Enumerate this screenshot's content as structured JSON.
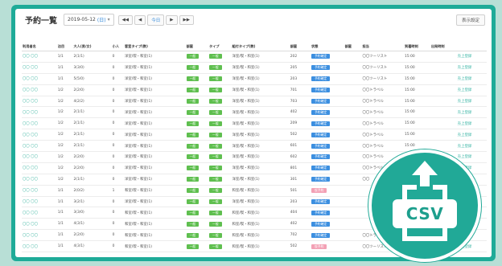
{
  "header": {
    "title": "予約一覧",
    "date_value": "2019-05-12",
    "weekday": "(日)",
    "caret": "▾",
    "nav_first": "◀◀",
    "nav_prev": "◀",
    "nav_today": "今日",
    "nav_next": "▶",
    "nav_last": "▶▶",
    "settings_button": "表示設定"
  },
  "table": {
    "columns": [
      "利用者名",
      "泊目",
      "大人(男/女)",
      "小人",
      "客室タイプ(数)",
      "部屋",
      "タイプ",
      "組付タイプ(数)",
      "部屋",
      "状態",
      "部屋",
      "担当",
      "到着時刻",
      "出発時刻",
      ""
    ],
    "rows": [
      {
        "name": "〇〇 〇〇",
        "nights": "1/1",
        "adults": "2(1/1)",
        "children": "0",
        "room_type": "洋室/喫・和室(1)",
        "tag1": "一般",
        "tag2": "一般",
        "combo": "洋室/喫・和室(1)",
        "room": "202",
        "status": "予約確定",
        "status_pink": false,
        "agent": "〇〇ツーリスト",
        "arrival": "15:00",
        "link": "売上登録"
      },
      {
        "name": "〇〇 〇〇",
        "nights": "1/1",
        "adults": "3(3/0)",
        "children": "0",
        "room_type": "洋室/喫・和室(1)",
        "tag1": "一般",
        "tag2": "一般",
        "combo": "洋室/喫・和室(1)",
        "room": "205",
        "status": "予約確定",
        "status_pink": false,
        "agent": "〇〇ツーリスト",
        "arrival": "15:00",
        "link": "売上登録"
      },
      {
        "name": "〇〇 〇〇",
        "nights": "1/1",
        "adults": "5(5/0)",
        "children": "0",
        "room_type": "洋室/喫・和室(1)",
        "tag1": "一般",
        "tag2": "一般",
        "combo": "洋室/喫・和室(1)",
        "room": "203",
        "status": "予約確定",
        "status_pink": false,
        "agent": "〇〇ツーリスト",
        "arrival": "15:00",
        "link": "売上登録"
      },
      {
        "name": "〇〇 〇〇",
        "nights": "1/2",
        "adults": "2(2/0)",
        "children": "0",
        "room_type": "洋室/喫・和室(1)",
        "tag1": "一般",
        "tag2": "一般",
        "combo": "洋室/喫・和室(1)",
        "room": "701",
        "status": "予約確定",
        "status_pink": false,
        "agent": "〇〇トラベル",
        "arrival": "15:00",
        "link": "売上登録"
      },
      {
        "name": "〇〇 〇〇",
        "nights": "1/2",
        "adults": "4(2/2)",
        "children": "0",
        "room_type": "洋室/喫・和室(1)",
        "tag1": "一般",
        "tag2": "一般",
        "combo": "洋室/喫・和室(1)",
        "room": "703",
        "status": "予約確定",
        "status_pink": false,
        "agent": "〇〇トラベル",
        "arrival": "15:00",
        "link": "売上登録"
      },
      {
        "name": "〇〇 〇〇",
        "nights": "1/2",
        "adults": "2(1/1)",
        "children": "0",
        "room_type": "洋室/喫・和室(1)",
        "tag1": "一般",
        "tag2": "一般",
        "combo": "洋室/喫・和室(1)",
        "room": "402",
        "status": "予約確定",
        "status_pink": false,
        "agent": "〇〇トラベル",
        "arrival": "15:00",
        "link": "売上登録"
      },
      {
        "name": "〇〇 〇〇",
        "nights": "1/2",
        "adults": "2(1/1)",
        "children": "0",
        "room_type": "洋室/喫・和室(1)",
        "tag1": "一般",
        "tag2": "一般",
        "combo": "洋室/喫・和室(1)",
        "room": "209",
        "status": "予約確定",
        "status_pink": false,
        "agent": "〇〇トラベル",
        "arrival": "15:00",
        "link": "売上登録"
      },
      {
        "name": "〇〇 〇〇",
        "nights": "1/2",
        "adults": "2(1/1)",
        "children": "0",
        "room_type": "洋室/喫・和室(1)",
        "tag1": "一般",
        "tag2": "一般",
        "combo": "洋室/喫・和室(1)",
        "room": "502",
        "status": "予約確定",
        "status_pink": false,
        "agent": "〇〇トラベル",
        "arrival": "15:00",
        "link": "売上登録"
      },
      {
        "name": "〇〇 〇〇",
        "nights": "1/2",
        "adults": "2(1/1)",
        "children": "0",
        "room_type": "洋室/喫・和室(1)",
        "tag1": "一般",
        "tag2": "一般",
        "combo": "洋室/喫・和室(1)",
        "room": "601",
        "status": "予約確定",
        "status_pink": false,
        "agent": "〇〇トラベル",
        "arrival": "15:00",
        "link": "売上登録"
      },
      {
        "name": "〇〇 〇〇",
        "nights": "1/2",
        "adults": "2(2/0)",
        "children": "0",
        "room_type": "洋室/喫・和室(1)",
        "tag1": "一般",
        "tag2": "一般",
        "combo": "洋室/喫・和室(1)",
        "room": "602",
        "status": "予約確定",
        "status_pink": false,
        "agent": "〇〇トラベル",
        "arrival": "",
        "link": "売上登録"
      },
      {
        "name": "〇〇 〇〇",
        "nights": "1/2",
        "adults": "2(2/0)",
        "children": "0",
        "room_type": "洋室/喫・和室(1)",
        "tag1": "一般",
        "tag2": "一般",
        "combo": "洋室/喫・和室(1)",
        "room": "801",
        "status": "予約確定",
        "status_pink": false,
        "agent": "〇〇トラベル",
        "arrival": "",
        "link": "売上登録"
      },
      {
        "name": "〇〇 〇〇",
        "nights": "1/2",
        "adults": "2(1/1)",
        "children": "0",
        "room_type": "洋室/喫・和室(1)",
        "tag1": "一般",
        "tag2": "一般",
        "combo": "洋室/喫・和室(1)",
        "room": "301",
        "status": "予約確定",
        "status_pink": false,
        "agent": "〇〇",
        "arrival": "",
        "link": "売上登録"
      },
      {
        "name": "〇〇 〇〇",
        "nights": "1/1",
        "adults": "2(0/2)",
        "children": "1",
        "room_type": "和室/喫・和室(1)",
        "tag1": "一般",
        "tag2": "一般",
        "combo": "和室/喫・和室(1)",
        "room": "501",
        "status": "仮予約",
        "status_pink": true,
        "agent": "",
        "arrival": "",
        "link": "売上登録"
      },
      {
        "name": "〇〇 〇〇",
        "nights": "1/1",
        "adults": "3(2/1)",
        "children": "0",
        "room_type": "洋室/喫・和室(1)",
        "tag1": "一般",
        "tag2": "一般",
        "combo": "洋室/喫・和室(1)",
        "room": "203",
        "status": "予約確定",
        "status_pink": false,
        "agent": "",
        "arrival": "",
        "link": "売上登録"
      },
      {
        "name": "〇〇 〇〇",
        "nights": "1/1",
        "adults": "3(3/0)",
        "children": "0",
        "room_type": "和室/喫・和室(1)",
        "tag1": "一般",
        "tag2": "一般",
        "combo": "和室/喫・和室(1)",
        "room": "404",
        "status": "予約確定",
        "status_pink": false,
        "agent": "",
        "arrival": "",
        "link": "売上登録"
      },
      {
        "name": "〇〇 〇〇",
        "nights": "1/1",
        "adults": "4(3/1)",
        "children": "0",
        "room_type": "和室/喫・和室(1)",
        "tag1": "一般",
        "tag2": "一般",
        "combo": "和室/喫・和室(1)",
        "room": "402",
        "status": "予約確定",
        "status_pink": false,
        "agent": "",
        "arrival": "",
        "link": "売上登録"
      },
      {
        "name": "〇〇 〇〇",
        "nights": "1/1",
        "adults": "2(2/0)",
        "children": "0",
        "room_type": "和室/喫・和室(1)",
        "tag1": "一般",
        "tag2": "一般",
        "combo": "和室/喫・和室(1)",
        "room": "702",
        "status": "予約確定",
        "status_pink": false,
        "agent": "〇〇トラベル",
        "arrival": "",
        "link": "売上登録"
      },
      {
        "name": "〇〇 〇〇",
        "nights": "1/1",
        "adults": "4(3/1)",
        "children": "0",
        "room_type": "和室/喫・和室(1)",
        "tag1": "一般",
        "tag2": "一般",
        "combo": "和室/喫・和室(1)",
        "room": "502",
        "status": "仮予約",
        "status_pink": true,
        "agent": "〇〇ツーリスト",
        "arrival": "",
        "link": "売上登録"
      }
    ]
  },
  "badge": {
    "label": "CSV",
    "icon": "csv-export-icon"
  },
  "colors": {
    "frame": "#1eab98",
    "background": "#b8dfd6",
    "tag_green": "#5fbf4f",
    "status_blue": "#3c8fe0",
    "status_pink": "#f3a1b5"
  }
}
